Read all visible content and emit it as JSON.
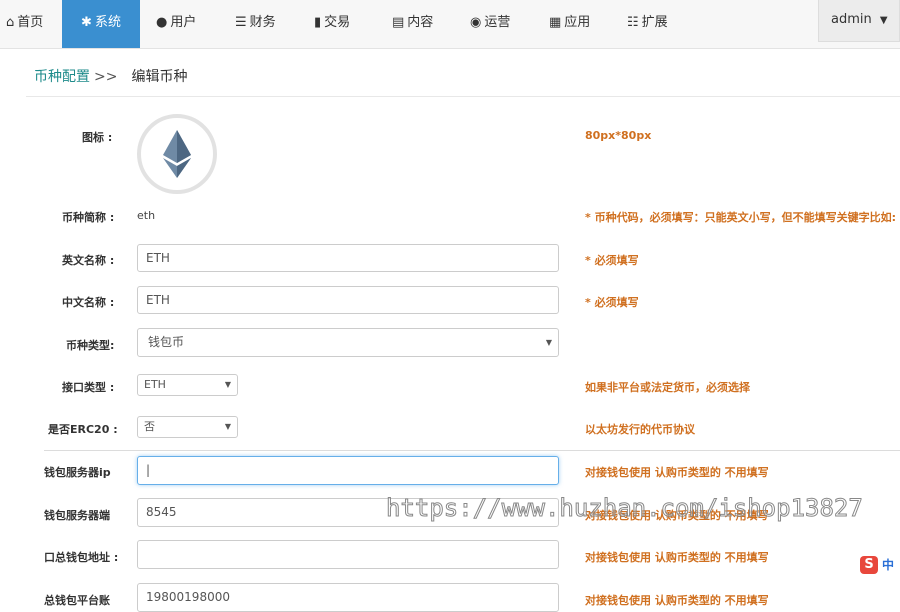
{
  "nav": {
    "items": [
      {
        "icon": "home-icon",
        "glyph": "⌂",
        "label": "首页"
      },
      {
        "icon": "gear-icon",
        "glyph": "✱",
        "label": "系统"
      },
      {
        "icon": "user-icon",
        "glyph": "●",
        "label": "用户"
      },
      {
        "icon": "list-icon",
        "glyph": "☰",
        "label": "财务"
      },
      {
        "icon": "bar-chart-icon",
        "glyph": "▮",
        "label": "交易"
      },
      {
        "icon": "document-icon",
        "glyph": "▤",
        "label": "内容"
      },
      {
        "icon": "globe-icon",
        "glyph": "◉",
        "label": "运营"
      },
      {
        "icon": "grid-icon",
        "glyph": "▦",
        "label": "应用"
      },
      {
        "icon": "extend-icon",
        "glyph": "☷",
        "label": "扩展"
      }
    ],
    "active_index": 1,
    "user": "admin",
    "user_caret": "▼"
  },
  "breadcrumb": {
    "link": "币种配置",
    "sep": ">>",
    "current": "编辑币种"
  },
  "form": {
    "icon_label": "图标 :",
    "icon_hint": "80px*80px",
    "short_label": "币种简称 :",
    "short_value": "eth",
    "short_hint": "* 币种代码，必须填写：只能英文小写，但不能填写关键字比如:",
    "en_label": "英文名称 :",
    "en_value": "ETH",
    "en_hint": "* 必须填写",
    "cn_label": "中文名称 :",
    "cn_value": "ETH",
    "cn_hint": "* 必须填写",
    "type_label": "币种类型:",
    "type_value": "钱包币",
    "api_label": "接口类型 :",
    "api_value": "ETH",
    "api_hint": "如果非平台或法定货币，必须选择",
    "erc20_label": "是否ERC20 :",
    "erc20_value": "否",
    "erc20_hint": "以太坊发行的代币协议",
    "ip_label": "钱包服务器ip",
    "ip_value": "|",
    "ip_hint": "对接钱包使用 认购币类型的 不用填写",
    "port_label": "钱包服务器端",
    "port_value": "8545",
    "port_hint": "对接钱包使用 认购币类型的 不用填写",
    "addr_label": "口总钱包地址 :",
    "addr_value": "",
    "addr_hint": "对接钱包使用 认购币类型的 不用填写",
    "account_label": "总钱包平台账",
    "account_value": "19800198000",
    "account_hint": "对接钱包使用 认购币类型的 不用填写"
  },
  "watermark": "https://www.huzhan.com/ishop13827",
  "ime": {
    "logo": "S",
    "text": "中"
  }
}
